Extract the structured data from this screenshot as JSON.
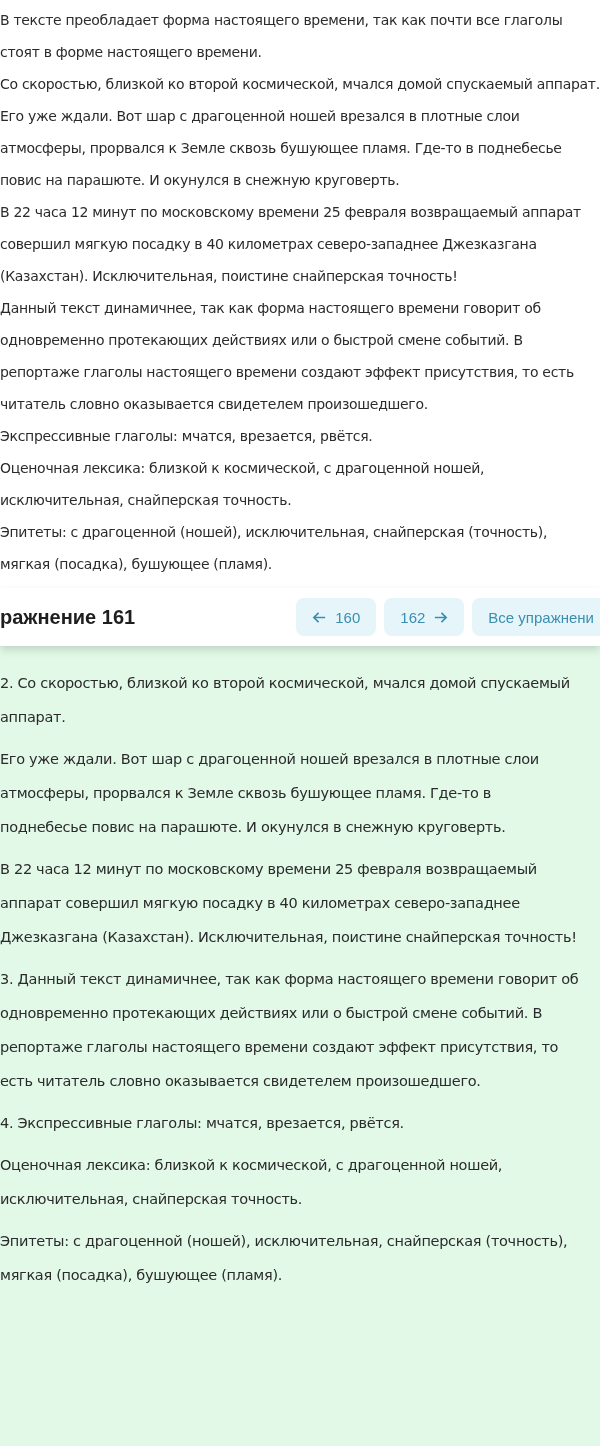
{
  "answer_paragraphs": [
    "В тексте преобладает форма настоящего времени, так как почти все глаголы стоят в форме настоящего времени.",
    "Со скоростью, близкой ко второй космической, мчался домой спускаемый аппарат.",
    "Его уже ждали. Вот шар с драгоценной ношей врезался в плотные слои атмосферы, прорвался к Земле сквозь бушующее пламя. Где-то в поднебесье повис на парашюте. И окунулся в снежную круговерть.",
    "В 22 часа 12 минут по московскому времени 25 февраля возвращаемый аппарат совершил мягкую посадку в 40 километрах северо-западнее Джезказгана (Казахстан). Исключительная, поистине снайперская точность!",
    "Данный текст динамичнее, так как форма настоящего времени говорит об одновременно протекающих действиях или о быстрой смене событий. В репортаже глаголы настоящего времени создают эффект присутствия, то есть читатель словно оказывается свидетелем произошедшего.",
    "Экспрессивные глаголы: мчатся, врезается, рвётся.",
    "Оценочная лексика: близкой к космической, с драгоценной ношей, исключительная, снайперская точность.",
    "Эпитеты: с драгоценной (ношей), исключительная, снайперская (точность), мягкая (посадка), бушующее (пламя)."
  ],
  "header": {
    "title": "ражнение 161",
    "nav": [
      {
        "kind": "prev",
        "label": "160"
      },
      {
        "kind": "next",
        "label": "162"
      },
      {
        "kind": "all",
        "label": "Все упражнени"
      }
    ]
  },
  "alt_answer_paragraphs": [
    "2. Со скоростью, близкой ко второй космической, мчался домой спускаемый аппарат.",
    "Его уже ждали. Вот шар с драгоценной ношей врезался в плотные слои атмосферы, прорвался к Земле сквозь бушующее пламя. Где-то в поднебесье повис на парашюте. И окунулся в снежную круговерть.",
    "В 22 часа 12 минут по московскому времени 25 февраля возвращаемый аппарат совершил мягкую посадку в 40 километрах северо-западнее Джезказгана (Казахстан). Исключительная, поистине снайперская точность!",
    "3. Данный текст динамичнее, так как форма настоящего времени говорит об одновременно протекающих действиях или о быстрой смене событий. В репортаже глаголы настоящего времени создают эффект присутствия, то есть читатель словно оказывается свидетелем произошедшего.",
    "4. Экспрессивные глаголы: мчатся, врезается, рвётся.",
    "Оценочная лексика: близкой к космической, с драгоценной ношей, исключительная, снайперская точность.",
    "Эпитеты: с драгоценной (ношей), исключительная, снайперская (точность), мягкая (посадка), бушующее (пламя)."
  ]
}
